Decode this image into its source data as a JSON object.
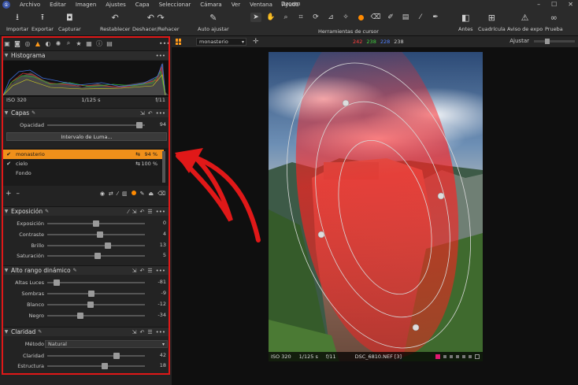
{
  "menubar": {
    "items": [
      "Archivo",
      "Editar",
      "Imagen",
      "Ajustes",
      "Capa",
      "Seleccionar",
      "Cámara",
      "Ver",
      "Ventana",
      "Ayuda"
    ],
    "doc_title": "Dzoom"
  },
  "toolbar": {
    "import_label": "Importar",
    "export_label": "Exportar",
    "capture_label": "Capturar",
    "reset_label": "Restablecer",
    "undo_redo_label": "Deshacer/Rehacer",
    "auto_adjust_label": "Auto ajustar",
    "cursor_tools_label": "Herramientas de cursor",
    "before_label": "Antes",
    "grid_label": "Cuadrícula",
    "exposure_warning_label": "Aviso de expo",
    "proof_label": "Prueba"
  },
  "histogram": {
    "title": "Histograma",
    "iso": "ISO 320",
    "shutter": "1/125 s",
    "aperture": "f/11"
  },
  "layers": {
    "title": "Capas",
    "opacity_label": "Opacidad",
    "opacity_value": "94",
    "opacity_fraction": 0.94,
    "luma_button": "Intervalo de Luma...",
    "items": [
      {
        "name": "monasterio",
        "value": "94 %",
        "checked": true,
        "selected": true
      },
      {
        "name": "cielo",
        "value": "100 %",
        "checked": true,
        "selected": false
      },
      {
        "name": "Fondo",
        "value": "",
        "checked": false,
        "selected": false
      }
    ]
  },
  "exposure": {
    "title": "Exposición",
    "rows": [
      {
        "label": "Exposición",
        "value": "0",
        "pos": 0.5
      },
      {
        "label": "Contraste",
        "value": "4",
        "pos": 0.54
      },
      {
        "label": "Brillo",
        "value": "13",
        "pos": 0.62
      },
      {
        "label": "Saturación",
        "value": "5",
        "pos": 0.52
      }
    ]
  },
  "hdr": {
    "title": "Alto rango dinámico",
    "rows": [
      {
        "label": "Altas Luces",
        "value": "-81",
        "pos": 0.1
      },
      {
        "label": "Sombras",
        "value": "-9",
        "pos": 0.45
      },
      {
        "label": "Blanco",
        "value": "-12",
        "pos": 0.44
      },
      {
        "label": "Negro",
        "value": "-34",
        "pos": 0.34
      }
    ]
  },
  "clarity": {
    "title": "Claridad",
    "method_label": "Método",
    "method_value": "Natural",
    "rows": [
      {
        "label": "Claridad",
        "value": "42",
        "pos": 0.71
      },
      {
        "label": "Estructura",
        "value": "18",
        "pos": 0.59
      }
    ]
  },
  "viewer": {
    "variant_name": "monasterio",
    "rgb": {
      "r": "242",
      "g": "238",
      "b": "228",
      "l": "238"
    },
    "fit_label": "Ajustar",
    "meta": {
      "iso": "ISO 320",
      "shutter": "1/125 s",
      "aperture": "f/11",
      "filename": "DSC_6810.NEF [3]"
    }
  },
  "colors": {
    "accent": "#f0901a",
    "annotation_red": "#e01818",
    "rgb_red": "#ff4040",
    "rgb_green": "#40d040",
    "rgb_blue": "#5080ff"
  }
}
